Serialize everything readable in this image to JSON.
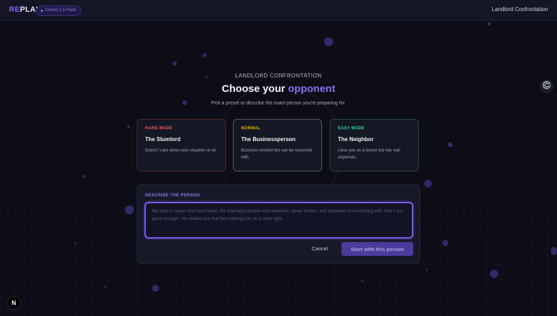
{
  "header": {
    "logo_prefix": "RE",
    "logo_suffix": "PLAI",
    "model_badge": "Gemini 2.5 Flash",
    "page_title": "Landlord Confrontation"
  },
  "intro": {
    "eyebrow": "LANDLORD CONFRONTATION",
    "headline_prefix": "Choose your",
    "headline_accent": "opponent",
    "subtitle": "Pick a preset or describe the exact person you're preparing for."
  },
  "cards": [
    {
      "mode": "HARD MODE",
      "title": "The Slumlord",
      "description": "Doesn't care about your situation at all."
    },
    {
      "mode": "NORMAL",
      "title": "The Businessperson",
      "description": "Business-minded but can be reasoned with."
    },
    {
      "mode": "EASY MODE",
      "title": "The Neighbor",
      "description": "Likes you as a tenant but has real expenses."
    }
  ],
  "describe": {
    "label": "DESCRIBE THE PERSON",
    "value": "",
    "placeholder": "My boss is super strict and harsh. He interrupts people mid-sentence, never smiles, and responds to everything with 'that's not good enough.' He makes you feel like nothing you do is ever right.",
    "cancel_label": "Cancel",
    "start_label": "Start with this person"
  },
  "badge_letter": "N",
  "icons": {
    "side": "target-icon",
    "badge": "n-logo-icon",
    "model": "dot-icon"
  },
  "colors": {
    "accent": "#8b6cf0",
    "hard": "#ef5a5a",
    "normal": "#eab308",
    "easy": "#34d399"
  }
}
